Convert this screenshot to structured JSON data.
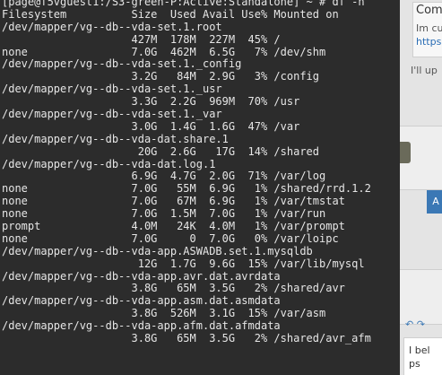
{
  "terminal": {
    "prompt": "[page@f5vguest1:/S3-green-P:Active:Standalone] ~ # df -h",
    "lines": [
      "Filesystem          Size  Used Avail Use% Mounted on",
      "/dev/mapper/vg--db--vda-set.1.root",
      "                    427M  178M  227M  45% /",
      "none                7.0G  462M  6.5G   7% /dev/shm",
      "/dev/mapper/vg--db--vda-set.1._config",
      "                    3.2G   84M  2.9G   3% /config",
      "/dev/mapper/vg--db--vda-set.1._usr",
      "                    3.3G  2.2G  969M  70% /usr",
      "/dev/mapper/vg--db--vda-set.1._var",
      "                    3.0G  1.4G  1.6G  47% /var",
      "/dev/mapper/vg--db--vda-dat.share.1",
      "                     20G  2.6G   17G  14% /shared",
      "/dev/mapper/vg--db--vda-dat.log.1",
      "                    6.9G  4.7G  2.0G  71% /var/log",
      "none                7.0G   55M  6.9G   1% /shared/rrd.1.2",
      "none                7.0G   67M  6.9G   1% /var/tmstat",
      "none                7.0G  1.5M  7.0G   1% /var/run",
      "prompt              4.0M   24K  4.0M   1% /var/prompt",
      "none                7.0G     0  7.0G   0% /var/loipc",
      "/dev/mapper/vg--db--vda-app.ASWADB.set.1.mysqldb",
      "                     12G  1.7G  9.6G  15% /var/lib/mysql",
      "/dev/mapper/vg--db--vda-app.avr.dat.avrdata",
      "                    3.8G   65M  3.5G   2% /shared/avr",
      "/dev/mapper/vg--db--vda-app.asm.dat.asmdata",
      "                    3.8G  526M  3.1G  15% /var/asm",
      "/dev/mapper/vg--db--vda-app.afm.dat.afmdata",
      "                    3.8G   65M  3.5G   2% /shared/avr_afm"
    ]
  },
  "background": {
    "heading_fragment": "Com",
    "line1_fragment": "Im cu",
    "link_fragment": "https",
    "line2_fragment": "I'll up",
    "button_fragment": "A",
    "reply_fragment": "I bel",
    "reply2_fragment": "ps"
  }
}
